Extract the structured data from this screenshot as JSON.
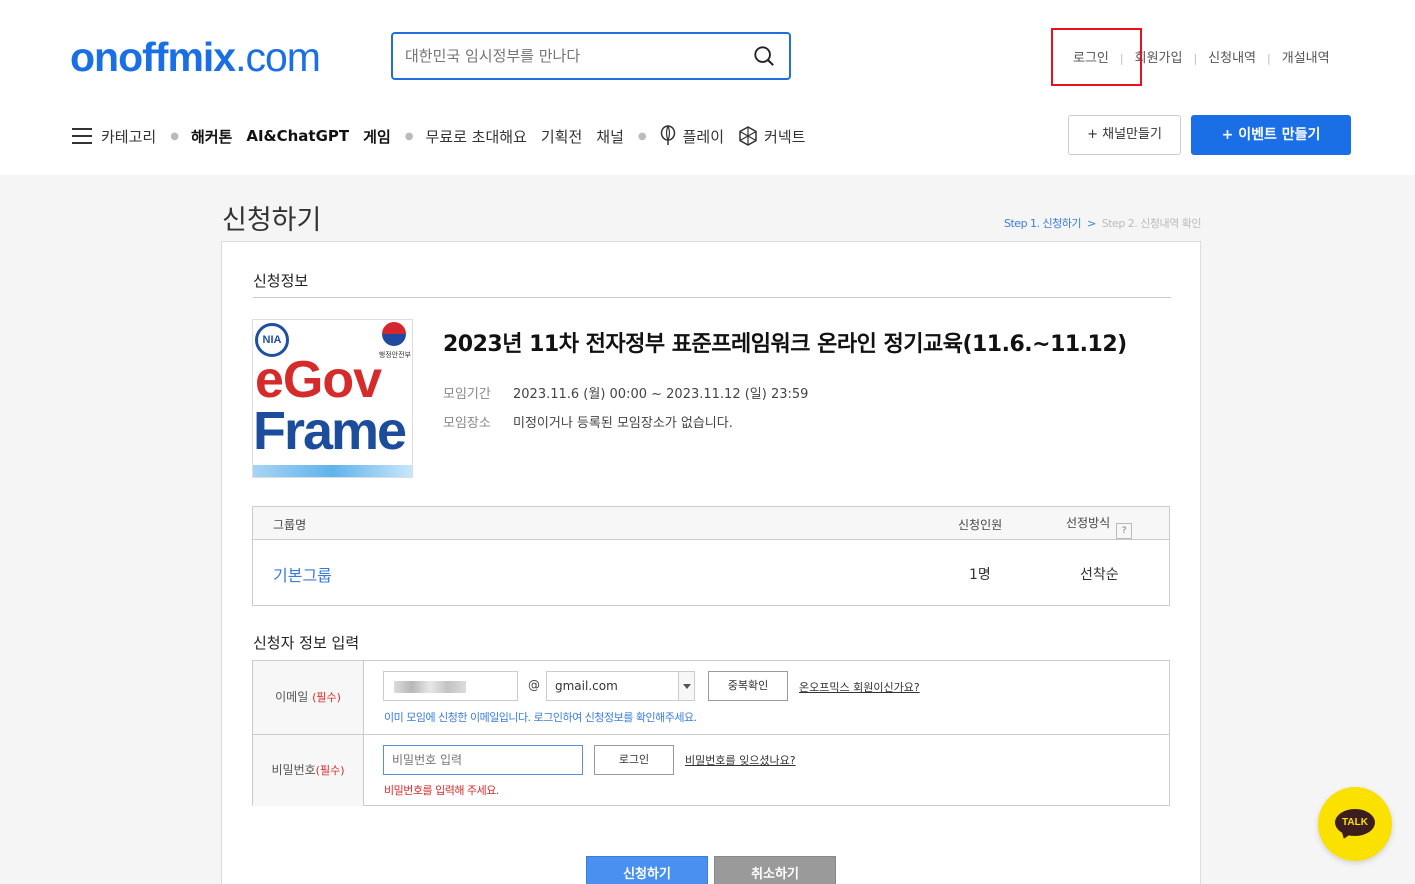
{
  "header": {
    "logo_main": "onoffmix",
    "logo_tld": ".com",
    "search_placeholder": "대한민국 임시정부를 만나다",
    "top_links": [
      "로그인",
      "회원가입",
      "신청내역",
      "개설내역"
    ],
    "nav": {
      "category": "카테고리",
      "items_bold": [
        "해커톤",
        "AI&ChatGPT",
        "게임"
      ],
      "items": [
        "무료로 초대해요",
        "기획전",
        "채널"
      ],
      "play": "플레이",
      "connect": "커넥트"
    },
    "btn_channel": "+  채널만들기",
    "btn_event": "+  이벤트 만들기"
  },
  "page": {
    "title": "신청하기",
    "step1": "Step 1. 신청하기",
    "step_arrow": ">",
    "step2": "Step 2. 신청내역 확인"
  },
  "event": {
    "section_title": "신청정보",
    "thumb_nia": "NIA",
    "thumb_ministry": "행정안전부",
    "thumb_line1": "eGov",
    "thumb_line2": "Frame",
    "title": "2023년 11차 전자정부 표준프레임워크 온라인 정기교육(11.6.~11.12)",
    "period_label": "모임기간",
    "period": "2023.11.6 (월) 00:00 ~ 2023.11.12 (일) 23:59",
    "place_label": "모임장소",
    "place": "미정이거나 등록된 모임장소가 없습니다."
  },
  "group_table": {
    "headers": [
      "그룹명",
      "신청인원",
      "선정방식"
    ],
    "help": "?",
    "row": {
      "name": "기본그룹",
      "count": "1명",
      "method": "선착순"
    }
  },
  "form": {
    "section_title": "신청자 정보 입력",
    "email_label": "이메일",
    "required": "(필수)",
    "at": "@",
    "email_domain": "gmail.com",
    "dup_check": "중복확인",
    "member_link": "온오프믹스 회원이신가요?",
    "email_hint": "이미 모임에 신청한 이메일입니다. 로그인하여 신청정보를 확인해주세요.",
    "password_label": "비밀번호",
    "password_placeholder": "비밀번호 입력",
    "login_btn": "로그인",
    "forgot_link": "비밀번호를 잊으셨나요?",
    "password_hint": "비밀번호를 입력해 주세요."
  },
  "actions": {
    "apply": "신청하기",
    "cancel": "취소하기"
  },
  "kakao": {
    "label": "TALK"
  },
  "colors": {
    "brand": "#1b6fe4",
    "accent_red": "#e8121c",
    "kakao": "#fae100"
  }
}
